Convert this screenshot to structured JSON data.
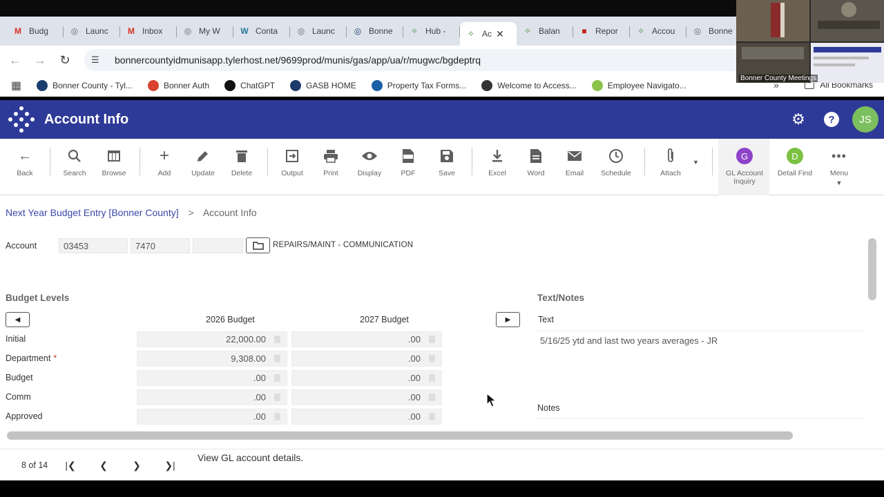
{
  "browser": {
    "tabs": [
      {
        "label": "Budg",
        "icon": "gmail-icon",
        "color": "#d93025"
      },
      {
        "label": "Launc",
        "icon": "globe-icon",
        "color": "#5f6368"
      },
      {
        "label": "Inbox",
        "icon": "gmail-icon",
        "color": "#d93025"
      },
      {
        "label": "My W",
        "icon": "globe-icon",
        "color": "#5f6368"
      },
      {
        "label": "Conta",
        "icon": "wordpress-icon",
        "color": "#21759b"
      },
      {
        "label": "Launc",
        "icon": "globe-icon",
        "color": "#5f6368"
      },
      {
        "label": "Bonne",
        "icon": "globe-icon",
        "color": "#1a3d6d"
      },
      {
        "label": "Hub -",
        "icon": "tyler-icon",
        "color": "#4a8a3c"
      },
      {
        "label": "Ac",
        "icon": "tyler-icon",
        "color": "#4a8a3c",
        "active": true
      },
      {
        "label": "Balan",
        "icon": "tyler-icon",
        "color": "#4a8a3c"
      },
      {
        "label": "Repor",
        "icon": "pdf-icon",
        "color": "#c5221f"
      },
      {
        "label": "Accou",
        "icon": "tyler-icon",
        "color": "#4a8a3c"
      },
      {
        "label": "Bonne",
        "icon": "globe-icon",
        "color": "#5f6368"
      }
    ],
    "url": "bonnercountyidmunisapp.tylerhost.net/9699prod/munis/gas/app/ua/r/mugwc/bgdeptrq",
    "bookmarks": [
      {
        "label": "Bonner County - Tyl...",
        "color": "#1a3d6d"
      },
      {
        "label": "Bonner Auth",
        "color": "#d9432f"
      },
      {
        "label": "ChatGPT",
        "color": "#111111"
      },
      {
        "label": "GASB HOME",
        "color": "#1d3a6b"
      },
      {
        "label": "Property Tax Forms...",
        "color": "#1a5fa8"
      },
      {
        "label": "Welcome to Access...",
        "color": "#333333"
      },
      {
        "label": "Employee Navigato...",
        "color": "#8bc34a"
      }
    ],
    "all_bookmarks": "All Bookmarks",
    "video_label": "Bonner County Meetings"
  },
  "app": {
    "title": "Account Info",
    "avatar_initials": "JS",
    "brand_color": "#2e3a97"
  },
  "toolbar": {
    "back": "Back",
    "search": "Search",
    "browse": "Browse",
    "add": "Add",
    "update": "Update",
    "delete": "Delete",
    "output": "Output",
    "print": "Print",
    "display": "Display",
    "pdf": "PDF",
    "save": "Save",
    "excel": "Excel",
    "word": "Word",
    "email": "Email",
    "schedule": "Schedule",
    "attach": "Attach",
    "gl_inquiry_letter": "G",
    "gl_inquiry": "GL Account Inquiry",
    "detail_find_letter": "D",
    "detail_find": "Detail Find",
    "menu": "Menu"
  },
  "breadcrumb": {
    "parent": "Next Year Budget Entry [Bonner County]",
    "separator": ">",
    "current": "Account Info"
  },
  "account": {
    "label": "Account",
    "org": "03453",
    "object": "7470",
    "project": "",
    "description": "REPAIRS/MAINT - COMMUNICATION"
  },
  "budget_levels": {
    "title": "Budget Levels",
    "columns": [
      "2026 Budget",
      "2027 Budget"
    ],
    "rows": [
      {
        "label": "Initial",
        "required": false,
        "values": [
          "22,000.00",
          ".00"
        ]
      },
      {
        "label": "Department",
        "required": true,
        "values": [
          "9,308.00",
          ".00"
        ]
      },
      {
        "label": "Budget",
        "required": false,
        "values": [
          ".00",
          ".00"
        ]
      },
      {
        "label": "Comm",
        "required": false,
        "values": [
          ".00",
          ".00"
        ]
      },
      {
        "label": "Approved",
        "required": false,
        "values": [
          ".00",
          ".00"
        ]
      }
    ],
    "required_mark": "*"
  },
  "text_notes": {
    "title": "Text/Notes",
    "text_label": "Text",
    "text_value": "5/16/25 ytd and last two years averages - JR",
    "notes_label": "Notes"
  },
  "footer": {
    "record_position": "8 of 14",
    "status": "View GL account details."
  }
}
